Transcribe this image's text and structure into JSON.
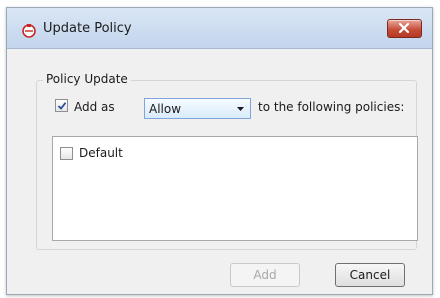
{
  "window": {
    "title": "Update Policy",
    "app_icon": "policy-icon",
    "close_icon": "close-icon"
  },
  "group": {
    "label": "Policy Update",
    "add_as_label": "Add as",
    "add_as_checked": true,
    "select": {
      "value": "Allow"
    },
    "suffix_text": "to the following policies:"
  },
  "policies": [
    {
      "label": "Default",
      "checked": false
    }
  ],
  "buttons": {
    "add": "Add",
    "add_enabled": false,
    "cancel": "Cancel"
  },
  "colors": {
    "window_bg": "#f0f0f0",
    "close_button": "#c44a36",
    "select_border": "#7ea7d8"
  }
}
